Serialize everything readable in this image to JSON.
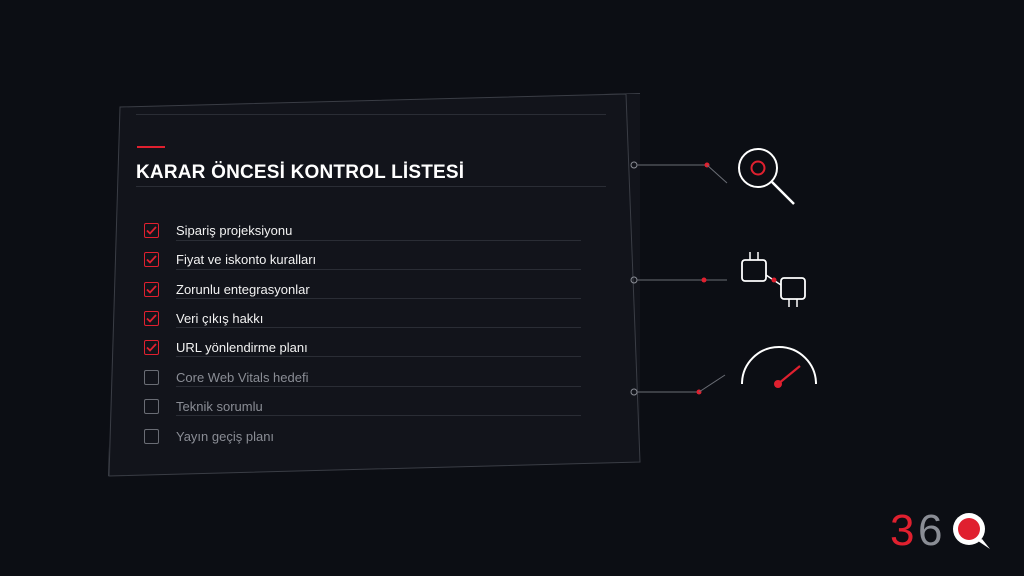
{
  "checklist": {
    "title": "KARAR ÖNCESİ KONTROL LİSTESİ",
    "items": [
      {
        "label": "Sipariş projeksiyonu",
        "checked": true
      },
      {
        "label": "Fiyat ve iskonto kuralları",
        "checked": true
      },
      {
        "label": "Zorunlu entegrasyonlar",
        "checked": true
      },
      {
        "label": "Veri çıkış hakkı",
        "checked": true
      },
      {
        "label": "URL yönlendirme planı",
        "checked": true
      },
      {
        "label": "Core Web Vitals hedefi",
        "checked": false
      },
      {
        "label": "Teknik sorumlu",
        "checked": false
      },
      {
        "label": "Yayın geçiş planı",
        "checked": false
      }
    ]
  },
  "icons": [
    "magnifier-icon",
    "plug-connection-icon",
    "speedometer-icon"
  ],
  "logo": {
    "text": "360"
  },
  "colors": {
    "accent": "#e0202f",
    "background": "#0c0e14",
    "card": "#12141b",
    "done_text": "#f2f2f2",
    "todo_text": "#8a8d95"
  }
}
